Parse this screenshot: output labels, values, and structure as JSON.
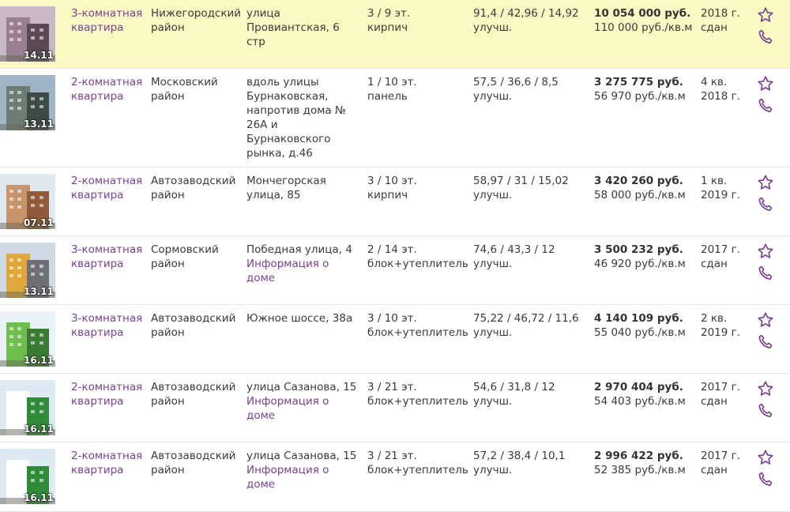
{
  "colors": {
    "link": "#7a3f8e",
    "highlight": "#fbf9c3"
  },
  "listings": [
    {
      "date": "14.11",
      "type": "3-комнатная квартира",
      "district": "Нижегородский район",
      "address": "улица Провиантская, 6 стр",
      "info": "",
      "floor": "3 / 9 эт.",
      "material": "кирпич",
      "area": "91,4 / 42,96 / 14,92",
      "finish": "улучш.",
      "price": "10 054 000 руб.",
      "price_sqm": "110 000 руб./кв.м",
      "deadline_year": "2018 г.",
      "deadline_status": "сдан"
    },
    {
      "date": "13.11",
      "type": "2-комнатная квартира",
      "district": "Московский район",
      "address": "вдоль улицы Бурнаковская, напротив дома № 26А и Бурнаковского рынка, д.46",
      "info": "",
      "floor": "1 / 10 эт.",
      "material": "панель",
      "area": "57,5 / 36,6 / 8,5",
      "finish": "улучш.",
      "price": "3 275 775 руб.",
      "price_sqm": "56 970 руб./кв.м",
      "deadline_year": "4 кв.",
      "deadline_status": "2018 г."
    },
    {
      "date": "07.11",
      "type": "2-комнатная квартира",
      "district": "Автозаводский район",
      "address": "Мончегорская улица, 85",
      "info": "",
      "floor": "3 / 10 эт.",
      "material": "кирпич",
      "area": "58,97 / 31 / 15,02",
      "finish": "улучш.",
      "price": "3 420 260 руб.",
      "price_sqm": "58 000 руб./кв.м",
      "deadline_year": "1 кв.",
      "deadline_status": "2019 г."
    },
    {
      "date": "13.11",
      "type": "3-комнатная квартира",
      "district": "Сормовский район",
      "address": "Победная улица, 4",
      "info": "Информация о доме",
      "floor": "2 / 14 эт.",
      "material": "блок+утеплитель",
      "area": "74,6 / 43,3 / 12",
      "finish": "улучш.",
      "price": "3 500 232 руб.",
      "price_sqm": "46 920 руб./кв.м",
      "deadline_year": "2017 г.",
      "deadline_status": "сдан"
    },
    {
      "date": "16.11",
      "type": "3-комнатная квартира",
      "district": "Автозаводский район",
      "address": "Южное шоссе, 38а",
      "info": "",
      "floor": "3 / 10 эт.",
      "material": "блок+утеплитель",
      "area": "75,22 / 46,72 / 11,6",
      "finish": "улучш.",
      "price": "4 140 109 руб.",
      "price_sqm": "55 040 руб./кв.м",
      "deadline_year": "2 кв.",
      "deadline_status": "2019 г."
    },
    {
      "date": "16.11",
      "type": "2-комнатная квартира",
      "district": "Автозаводский район",
      "address": "улица Сазанова, 15",
      "info": "Информация о доме",
      "floor": "3 / 21 эт.",
      "material": "блок+утеплитель",
      "area": "54,6 / 31,8 / 12",
      "finish": "улучш.",
      "price": "2 970 404 руб.",
      "price_sqm": "54 403 руб./кв.м",
      "deadline_year": "2017 г.",
      "deadline_status": "сдан"
    },
    {
      "date": "16.11",
      "type": "2-комнатная квартира",
      "district": "Автозаводский район",
      "address": "улица Сазанова, 15",
      "info": "Информация о доме",
      "floor": "3 / 21 эт.",
      "material": "блок+утеплитель",
      "area": "57,2 / 38,4 / 10,1",
      "finish": "улучш.",
      "price": "2 996 422 руб.",
      "price_sqm": "52 385 руб./кв.м",
      "deadline_year": "2017 г.",
      "deadline_status": "сдан"
    }
  ]
}
